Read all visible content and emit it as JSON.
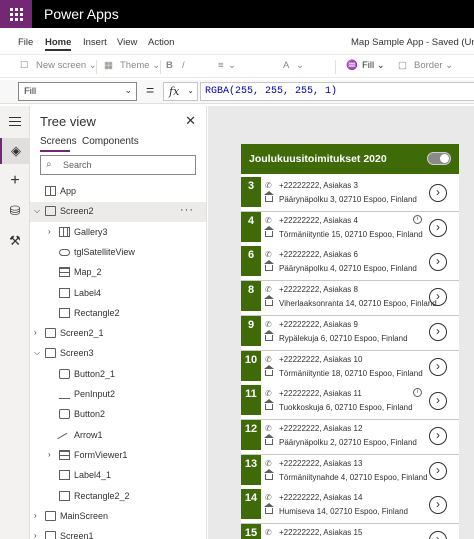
{
  "titlebar": {
    "app_name": "Power Apps"
  },
  "menu": {
    "items": [
      "File",
      "Home",
      "Insert",
      "View",
      "Action"
    ],
    "active": "Home",
    "doc_title": "Map Sample App - Saved (Unpu"
  },
  "ribbon": {
    "new_screen": "New screen",
    "theme": "Theme",
    "fill": "Fill",
    "border": "Border"
  },
  "formula": {
    "property": "Fill",
    "equals": "=",
    "fx": "fx",
    "expression": "RGBA(255, 255, 255, 1)"
  },
  "tree": {
    "title": "Tree view",
    "tabs": [
      "Screens",
      "Components"
    ],
    "active_tab": "Screens",
    "search_placeholder": "Search",
    "items": [
      {
        "label": "App",
        "indent": 0,
        "icon": "app-icon",
        "expand": ""
      },
      {
        "label": "Screen2",
        "indent": 0,
        "icon": "screen-icon",
        "expand": "expanded",
        "selected": true
      },
      {
        "label": "Gallery3",
        "indent": 1,
        "icon": "gallery-icon",
        "expand": "collapsed"
      },
      {
        "label": "tglSatelliteView",
        "indent": 1,
        "icon": "toggle-icon",
        "expand": ""
      },
      {
        "label": "Map_2",
        "indent": 1,
        "icon": "map-icon",
        "expand": ""
      },
      {
        "label": "Label4",
        "indent": 1,
        "icon": "label-icon",
        "expand": ""
      },
      {
        "label": "Rectangle2",
        "indent": 1,
        "icon": "rectangle-icon",
        "expand": ""
      },
      {
        "label": "Screen2_1",
        "indent": 0,
        "icon": "screen-icon",
        "expand": "collapsed"
      },
      {
        "label": "Screen3",
        "indent": 0,
        "icon": "screen-icon",
        "expand": "expanded"
      },
      {
        "label": "Button2_1",
        "indent": 1,
        "icon": "button-icon",
        "expand": ""
      },
      {
        "label": "PenInput2",
        "indent": 1,
        "icon": "pen-input-icon",
        "expand": ""
      },
      {
        "label": "Button2",
        "indent": 1,
        "icon": "button-icon",
        "expand": ""
      },
      {
        "label": "Arrow1",
        "indent": 1,
        "icon": "arrow-icon",
        "expand": ""
      },
      {
        "label": "FormViewer1",
        "indent": 1,
        "icon": "form-icon",
        "expand": "collapsed"
      },
      {
        "label": "Label4_1",
        "indent": 1,
        "icon": "label-icon",
        "expand": ""
      },
      {
        "label": "Rectangle2_2",
        "indent": 1,
        "icon": "rectangle-icon",
        "expand": ""
      },
      {
        "label": "MainScreen",
        "indent": 0,
        "icon": "screen-icon",
        "expand": "collapsed"
      },
      {
        "label": "Screen1",
        "indent": 0,
        "icon": "screen-icon",
        "expand": "collapsed"
      }
    ]
  },
  "app": {
    "header_title": "Joulukuusitoimitukset 2020",
    "accent_color": "#3e6b08",
    "satellite_toggle_on": true,
    "rows": [
      {
        "num": "3",
        "line1": "+22222222, Asiakas 3",
        "line2": "Päärynäpolku 3, 02710 Espoo, Finland",
        "info": false
      },
      {
        "num": "4",
        "line1": "+22222222, Asiakas 4",
        "line2": "Törmäniityntie 15, 02710 Espoo, Finland",
        "info": true
      },
      {
        "num": "6",
        "line1": "+22222222, Asiakas 6",
        "line2": "Päärynäpolku 4, 02710 Espoo, Finland",
        "info": false
      },
      {
        "num": "8",
        "line1": "+22222222, Asiakas 8",
        "line2": "Viherlaaksonranta 14, 02710 Espoo, Finland",
        "info": false
      },
      {
        "num": "9",
        "line1": "+22222222, Asiakas 9",
        "line2": "Rypälekuja 6, 02710 Espoo, Finland",
        "info": false
      },
      {
        "num": "10",
        "line1": "+22222222, Asiakas 10",
        "line2": "Törmäniityntie 18, 02710 Espoo, Finland",
        "info": false
      },
      {
        "num": "11",
        "line1": "+22222222, Asiakas 11",
        "line2": "Tuokkoskuja 6, 02710 Espoo, Finland",
        "info": true
      },
      {
        "num": "12",
        "line1": "+22222222, Asiakas 12",
        "line2": "Päärynäpolku 2, 02710 Espoo, Finland",
        "info": false
      },
      {
        "num": "13",
        "line1": "+22222222, Asiakas 13",
        "line2": "Törmäniitynahde 4, 02710 Espoo, Finland",
        "info": false
      },
      {
        "num": "14",
        "line1": "+22222222, Asiakas 14",
        "line2": "Humiseva 14, 02710 Espoo, Finland",
        "info": false
      },
      {
        "num": "15",
        "line1": "+22222222, Asiakas 15",
        "line2": "",
        "info": false
      }
    ]
  }
}
